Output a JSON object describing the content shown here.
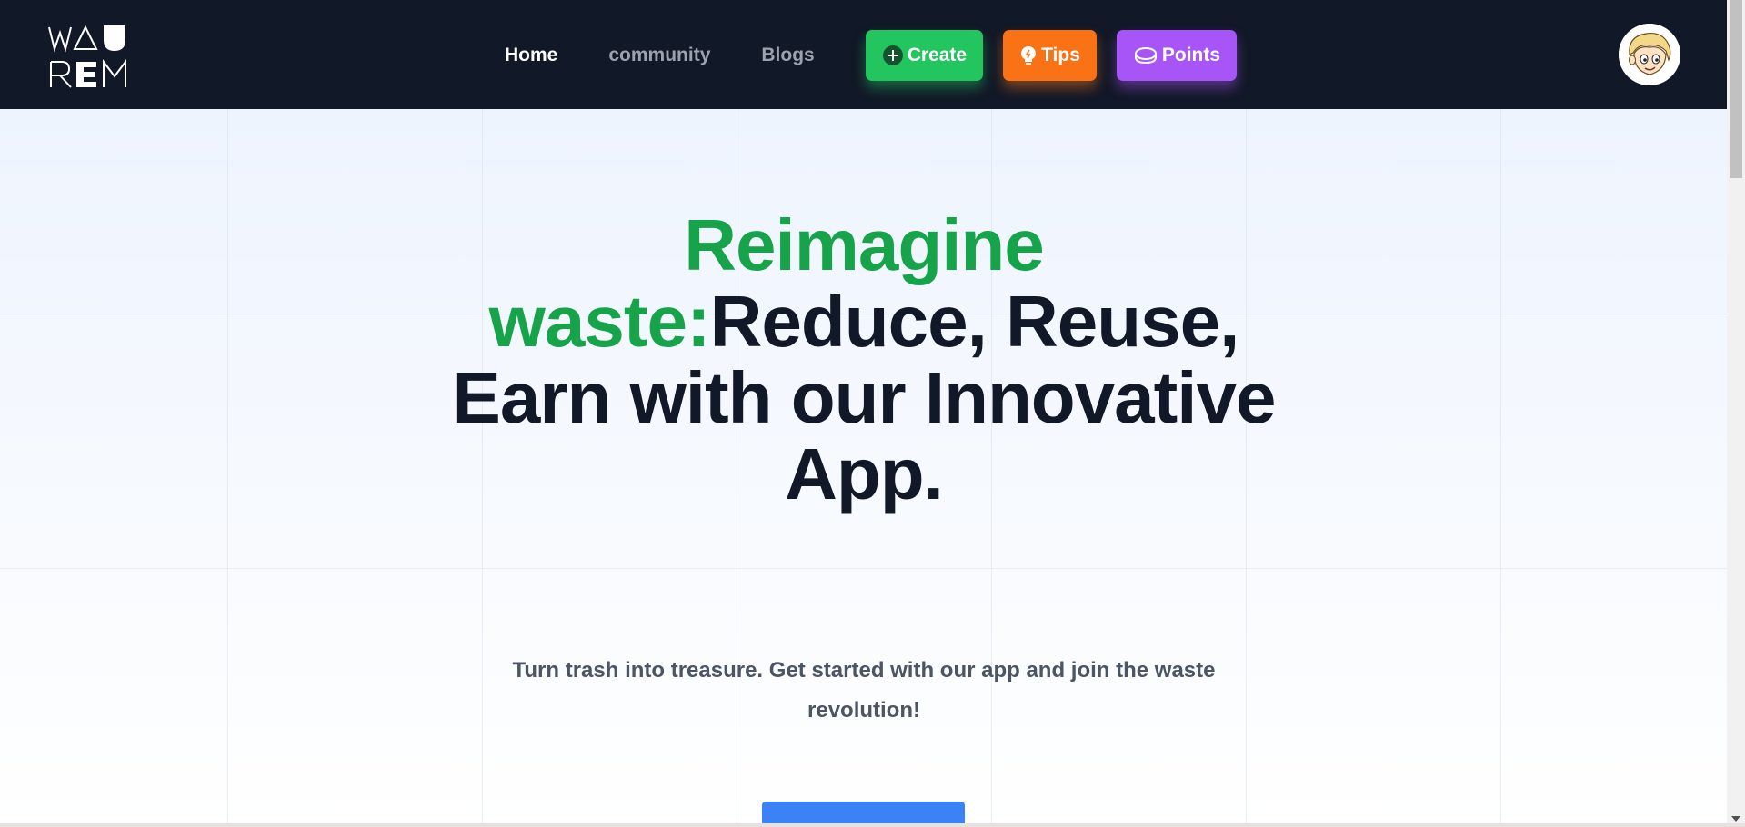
{
  "nav": {
    "links": [
      {
        "label": "Home",
        "active": true
      },
      {
        "label": "community",
        "active": false
      },
      {
        "label": "Blogs",
        "active": false
      }
    ],
    "buttons": {
      "create": {
        "label": "Create",
        "icon": "plus-circle-icon",
        "color": "#22c55e"
      },
      "tips": {
        "label": "Tips",
        "icon": "lightbulb-icon",
        "color": "#f97316"
      },
      "points": {
        "label": "Points",
        "icon": "coin-icon",
        "color": "#a855f7"
      }
    },
    "logo_text": "WAU REM",
    "avatar_icon": "user-avatar-icon"
  },
  "hero": {
    "headline_green": "Reimagine waste:",
    "headline_dark": "Reduce, Reuse, Earn with our Innovative App.",
    "subtext": "Turn trash into treasure. Get started with our app and join the waste revolution!",
    "accent_green": "#16a34a",
    "cta_color": "#3b82f6"
  },
  "colors": {
    "navbar_bg": "#111827",
    "hero_bg_top": "#eef4fe"
  }
}
